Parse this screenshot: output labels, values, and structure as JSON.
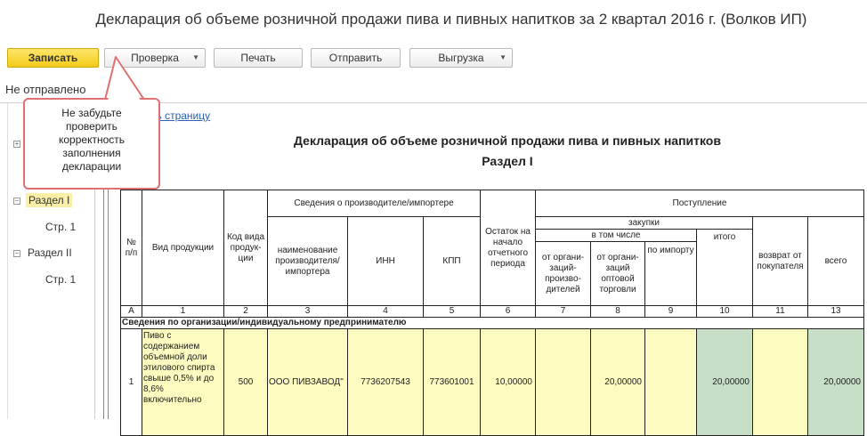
{
  "window": {
    "title": "Декларация об объеме розничной продажи пива и пивных напитков за 2 квартал 2016 г. (Волков ИП)"
  },
  "toolbar": {
    "save": "Записать",
    "check": "Проверка",
    "print": "Печать",
    "send": "Отправить",
    "export": "Выгрузка"
  },
  "status": "Не отправлено",
  "tooltip": {
    "lines": [
      "Не забудьте",
      "проверить",
      "корректность",
      "заполнения",
      "декларации"
    ]
  },
  "tree": {
    "items": [
      {
        "label": "Раздел I",
        "selected": true
      },
      {
        "label": "Стр. 1"
      },
      {
        "label": "Раздел II"
      },
      {
        "label": "Стр. 1"
      }
    ]
  },
  "doc": {
    "link": "ть страницу",
    "title": "Декларация об объеме розничной продажи пива и пивных напитков",
    "section": "Раздел I"
  },
  "table": {
    "headers": {
      "num": "№ п/п",
      "product": "Вид продукции",
      "code": "Код вида продук- ции",
      "producer_group": "Сведения о производителе/импортере",
      "producer_name": "наименование производителя/ импортера",
      "inn": "ИНН",
      "kpp": "КПП",
      "balance": "Остаток на начало отчетного периода",
      "income": "Поступление",
      "purchases": "закупки",
      "including": "в том числе",
      "from_producers": "от органи- заций- произво- дителей",
      "from_wholesale": "от органи- заций оптовой торговли",
      "by_import": "по импорту",
      "total": "итого",
      "return": "возврат от покупателя",
      "all": "всего"
    },
    "col_numbers": [
      "А",
      "1",
      "2",
      "3",
      "4",
      "5",
      "6",
      "7",
      "8",
      "9",
      "10",
      "11",
      "13"
    ],
    "section_row": "Сведения по организации/индивидуальному предпринимателю",
    "row": {
      "num": "1",
      "product": "Пиво с содержанием объемной доли этилового спирта свыше 0,5% и до 8,6% включительно",
      "code": "500",
      "producer": "ООО ПИВЗАВОД\"",
      "inn": "7736207543",
      "kpp": "773601001",
      "balance": "10,00000",
      "from_producers": "",
      "from_wholesale": "20,00000",
      "by_import": "",
      "total": "20,00000",
      "return": "",
      "all": "20,00000"
    }
  }
}
